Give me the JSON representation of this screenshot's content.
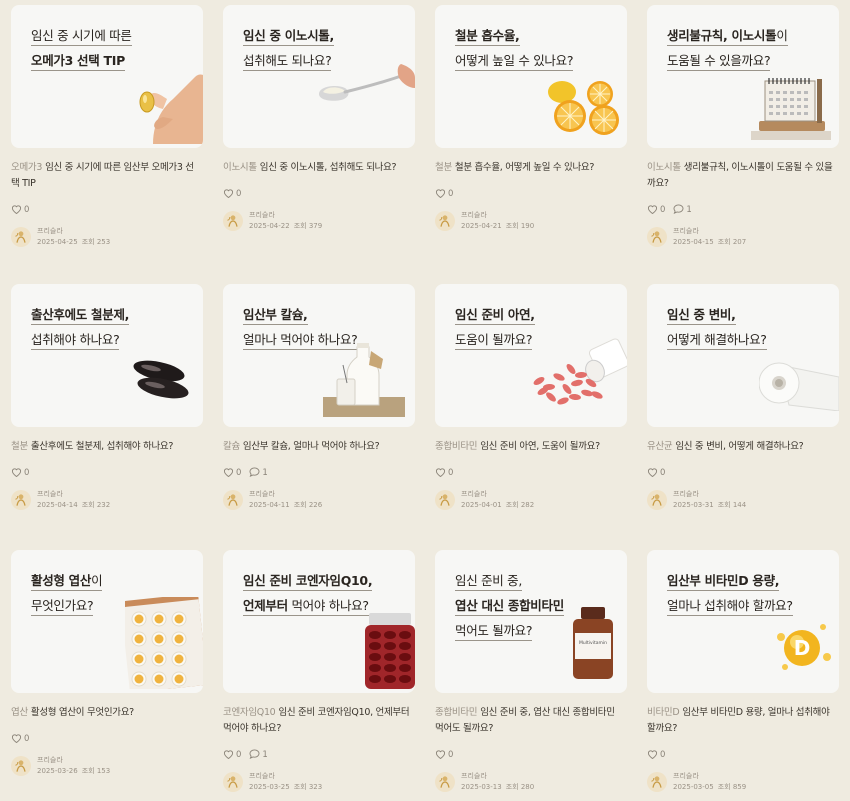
{
  "cards": [
    {
      "title_lines": [
        [
          {
            "t": "임신 중 시기에 따른",
            "b": false
          }
        ],
        [
          {
            "t": "오메가3 선택 TIP",
            "b": true
          }
        ]
      ],
      "category": "오메가3",
      "desc": "임신 중 시기에 따른 임산부 오메가3 선택 TIP",
      "likes": "0",
      "comments": null,
      "author": "프리슬라",
      "date": "2025-04-25",
      "views_label": "조회",
      "views": "253",
      "image": "fingers-holding-omega3-capsule"
    },
    {
      "title_lines": [
        [
          {
            "t": "임신 중 이노시톨,",
            "b": true
          }
        ],
        [
          {
            "t": "섭취해도 되나요?",
            "b": false
          }
        ]
      ],
      "category": "이노시톨",
      "desc": "임신 중 이노시톨, 섭취해도 되나요?",
      "likes": "0",
      "comments": null,
      "author": "프리슬라",
      "date": "2025-04-22",
      "views_label": "조회",
      "views": "379",
      "image": "hand-holding-spoon-powder"
    },
    {
      "title_lines": [
        [
          {
            "t": "철분 흡수율,",
            "b": true
          }
        ],
        [
          {
            "t": "어떻게 높일 수 있나요?",
            "b": false
          }
        ]
      ],
      "category": "철분",
      "desc": "철분 흡수율, 어떻게 높일 수 있나요?",
      "likes": "0",
      "comments": null,
      "author": "프리슬라",
      "date": "2025-04-21",
      "views_label": "조회",
      "views": "190",
      "image": "lemon-and-orange-slices"
    },
    {
      "title_lines": [
        [
          {
            "t": "생리불규칙, 이노시톨",
            "b": true
          },
          {
            "t": "이",
            "b": false
          }
        ],
        [
          {
            "t": "도움될 수 있을까요?",
            "b": false
          }
        ]
      ],
      "category": "이노시톨",
      "desc": "생리불규칙, 이노시톨이 도움될 수 있을까요?",
      "likes": "0",
      "comments": "1",
      "author": "프리슬라",
      "date": "2025-04-15",
      "views_label": "조회",
      "views": "207",
      "image": "desk-calendar"
    },
    {
      "title_lines": [
        [
          {
            "t": "출산후에도 철분제,",
            "b": true
          }
        ],
        [
          {
            "t": "섭취해야 하나요?",
            "b": false
          }
        ]
      ],
      "category": "철분",
      "desc": "출산후에도 철분제, 섭취해야 하나요?",
      "likes": "0",
      "comments": null,
      "author": "프리슬라",
      "date": "2025-04-14",
      "views_label": "조회",
      "views": "232",
      "image": "black-softgel-capsules"
    },
    {
      "title_lines": [
        [
          {
            "t": "임산부 칼슘,",
            "b": true
          }
        ],
        [
          {
            "t": "얼마나 먹어야 하나요?",
            "b": false
          }
        ]
      ],
      "category": "칼슘",
      "desc": "임산부 칼슘, 얼마나 먹어야 하나요?",
      "likes": "0",
      "comments": "1",
      "author": "프리슬라",
      "date": "2025-04-11",
      "views_label": "조회",
      "views": "226",
      "image": "milk-bottle-and-glass"
    },
    {
      "title_lines": [
        [
          {
            "t": "임신 준비 아연,",
            "b": true
          }
        ],
        [
          {
            "t": "도움이 될까요?",
            "b": false
          }
        ]
      ],
      "category": "종합비타민",
      "desc": "임신 준비 아연, 도움이 될까요?",
      "likes": "0",
      "comments": null,
      "author": "프리슬라",
      "date": "2025-04-01",
      "views_label": "조회",
      "views": "282",
      "image": "spilled-pink-pills"
    },
    {
      "title_lines": [
        [
          {
            "t": "임신 중 변비,",
            "b": true
          }
        ],
        [
          {
            "t": "어떻게 해결하나요?",
            "b": false
          }
        ]
      ],
      "category": "유산균",
      "desc": "임신 중 변비, 어떻게 해결하나요?",
      "likes": "0",
      "comments": null,
      "author": "프리슬라",
      "date": "2025-03-31",
      "views_label": "조회",
      "views": "144",
      "image": "toilet-paper-roll"
    },
    {
      "title_lines": [
        [
          {
            "t": "활성형 엽산",
            "b": true
          },
          {
            "t": "이",
            "b": false
          }
        ],
        [
          {
            "t": "무엇인가요?",
            "b": false
          }
        ]
      ],
      "category": "엽산",
      "desc": "활성형 엽산이 무엇인가요?",
      "likes": "0",
      "comments": null,
      "author": "프리슬라",
      "date": "2025-03-26",
      "views_label": "조회",
      "views": "153",
      "image": "blister-pack-yellow-pills"
    },
    {
      "title_lines": [
        [
          {
            "t": "임신 준비 코엔자임Q10,",
            "b": true
          }
        ],
        [
          {
            "t": "언제부터",
            "b": true
          },
          {
            "t": " 먹어야 하나요?",
            "b": false
          }
        ]
      ],
      "category": "코엔자임Q10",
      "desc": "임신 준비 코엔자임Q10, 언제부터 먹어야 하나요?",
      "likes": "0",
      "comments": "1",
      "author": "프리슬라",
      "date": "2025-03-25",
      "views_label": "조회",
      "views": "323",
      "image": "jar-of-red-capsules"
    },
    {
      "title_lines": [
        [
          {
            "t": "임신 준비 중,",
            "b": false
          }
        ],
        [
          {
            "t": "엽산 대신 종합비타민",
            "b": true
          }
        ],
        [
          {
            "t": "먹어도 될까요?",
            "b": false
          }
        ]
      ],
      "category": "종합비타민",
      "desc": "임신 준비 중, 엽산 대신 종합비타민 먹어도 될까요?",
      "likes": "0",
      "comments": null,
      "author": "프리슬라",
      "date": "2025-03-13",
      "views_label": "조회",
      "views": "280",
      "image": "multivitamin-bottle",
      "bottle_label": "Multivitamin"
    },
    {
      "title_lines": [
        [
          {
            "t": "임산부 비타민D 용량,",
            "b": true
          }
        ],
        [
          {
            "t": "얼마나 섭취해야 할까요?",
            "b": false
          }
        ]
      ],
      "category": "비타민D",
      "desc": "임산부 비타민D 용량, 얼마나 섭취해야 할까요?",
      "likes": "0",
      "comments": null,
      "author": "프리슬라",
      "date": "2025-03-05",
      "views_label": "조회",
      "views": "859",
      "image": "vitamin-d-gold-orb",
      "orb_letter": "D"
    }
  ]
}
